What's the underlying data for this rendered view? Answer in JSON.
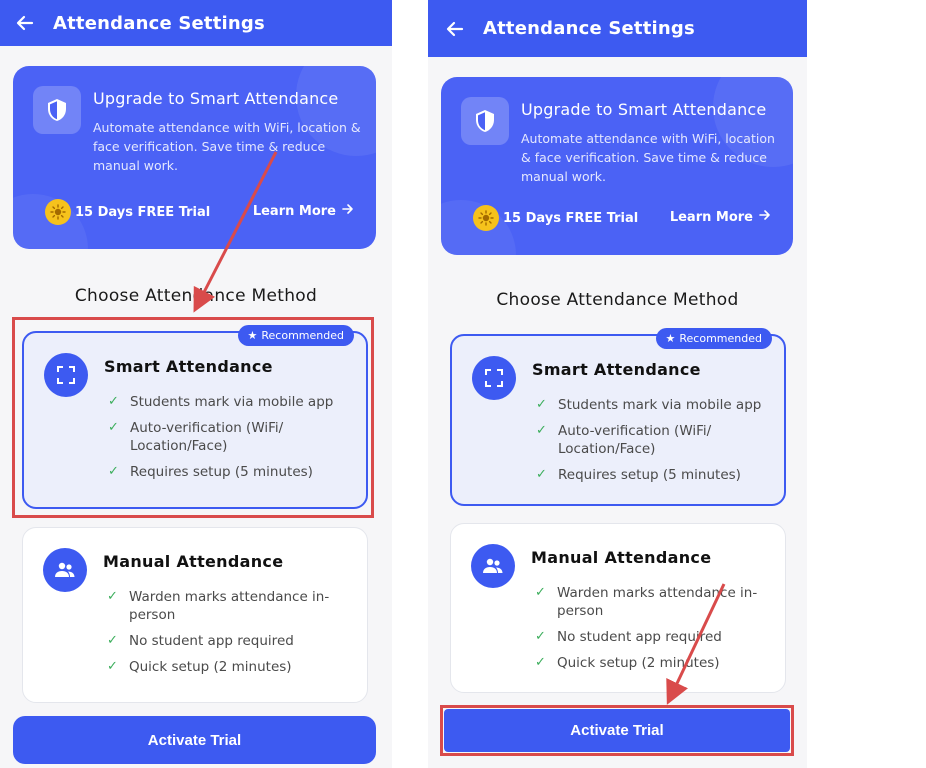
{
  "app": {
    "title": "Attendance Settings"
  },
  "promo": {
    "title": "Upgrade to Smart Attendance",
    "description": "Automate attendance with WiFi, location & face verification. Save time & reduce manual work.",
    "trial_label": "15 Days FREE Trial",
    "learn_more_label": "Learn More"
  },
  "section_title": "Choose Attendance Method",
  "methods": [
    {
      "title": "Smart Attendance",
      "badge": "Recommended",
      "selected": true,
      "features": [
        "Students mark via mobile app",
        "Auto-verification (WiFi/ Location/Face)",
        "Requires setup (5 minutes)"
      ]
    },
    {
      "title": "Manual Attendance",
      "selected": false,
      "features": [
        "Warden marks attendance in-person",
        "No student app required",
        "Quick setup (2 minutes)"
      ]
    }
  ],
  "cta_label": "Activate Trial",
  "colors": {
    "primary": "#3d5af1",
    "promo": "#4b62f5",
    "highlight": "#d94b4b",
    "check": "#3cae5c",
    "sun": "#f6c21c"
  },
  "icons": {
    "back": "arrow-left-icon",
    "shield": "shield-icon",
    "sun": "sun-icon",
    "scan": "scan-frame-icon",
    "people": "people-icon",
    "check": "check-icon",
    "star": "star-icon"
  }
}
